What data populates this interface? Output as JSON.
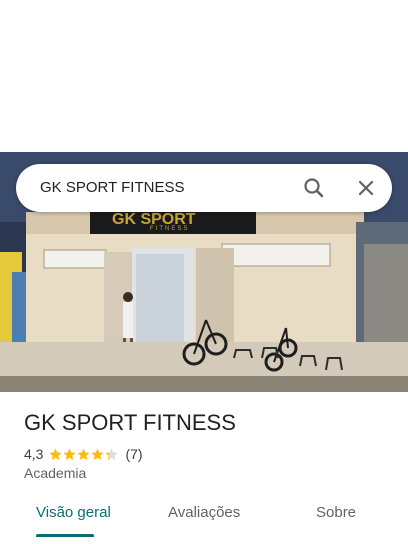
{
  "search": {
    "query": "GK SPORT FITNESS"
  },
  "photo": {
    "sign_text_top": "GK SPORT",
    "sign_text_bottom": "FITNESS"
  },
  "place": {
    "name": "GK SPORT FITNESS",
    "rating_value": "4,3",
    "rating_stars": 4.3,
    "review_count": "(7)",
    "category": "Academia"
  },
  "tabs": [
    {
      "label": "Visão geral",
      "active": true
    },
    {
      "label": "Avaliações",
      "active": false
    },
    {
      "label": "Sobre",
      "active": false
    }
  ],
  "colors": {
    "accent": "#0b6e76",
    "star": "#fbbc04"
  }
}
